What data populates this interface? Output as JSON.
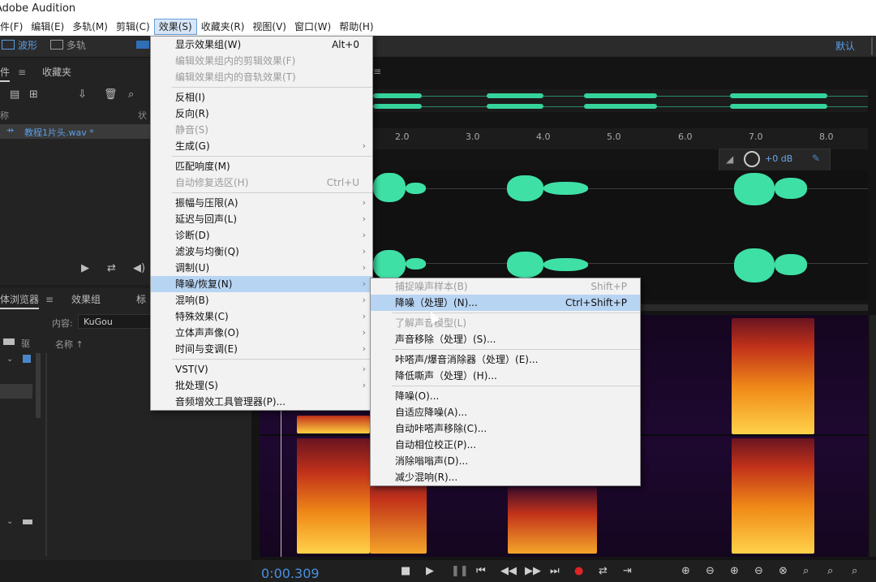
{
  "app": {
    "title": "Adobe Audition"
  },
  "menubar": {
    "items": [
      {
        "label": "件(F)"
      },
      {
        "label": "编辑(E)"
      },
      {
        "label": "多轨(M)"
      },
      {
        "label": "剪辑(C)"
      },
      {
        "label": "效果(S)"
      },
      {
        "label": "收藏夹(R)"
      },
      {
        "label": "视图(V)"
      },
      {
        "label": "窗口(W)"
      },
      {
        "label": "帮助(H)"
      }
    ]
  },
  "toolbar": {
    "waveform_label": "波形",
    "multitrack_label": "多轨",
    "workspace": "默认"
  },
  "files_panel": {
    "tabs": [
      "件",
      "收藏夹"
    ],
    "col_name": "称",
    "col_status": "状",
    "file_name": "教程1片头.wav *"
  },
  "media_panel": {
    "tabs": [
      "体浏览器",
      "效果组",
      "标"
    ],
    "content_label": "内容:",
    "content_value": "KuGou",
    "col_name": "名称 ↑",
    "drive_label": "驱"
  },
  "ruler": {
    "labels": [
      "2.0",
      "3.0",
      "4.0",
      "5.0",
      "6.0",
      "7.0",
      "8.0"
    ]
  },
  "hud": {
    "volume": "+0 dB"
  },
  "effects_menu": {
    "items": [
      {
        "label": "显示效果组(W)",
        "shortcut": "Alt+0",
        "disabled": false,
        "arrow": false
      },
      {
        "label": "编辑效果组内的剪辑效果(F)",
        "disabled": true
      },
      {
        "label": "编辑效果组内的音轨效果(T)",
        "disabled": true
      },
      {
        "sep": true
      },
      {
        "label": "反相(I)"
      },
      {
        "label": "反向(R)"
      },
      {
        "label": "静音(S)",
        "disabled": true
      },
      {
        "label": "生成(G)",
        "arrow": true
      },
      {
        "sep": true
      },
      {
        "label": "匹配响度(M)"
      },
      {
        "label": "自动修复选区(H)",
        "shortcut": "Ctrl+U",
        "disabled": true
      },
      {
        "sep": true
      },
      {
        "label": "振幅与压限(A)",
        "arrow": true
      },
      {
        "label": "延迟与回声(L)",
        "arrow": true
      },
      {
        "label": "诊断(D)",
        "arrow": true
      },
      {
        "label": "滤波与均衡(Q)",
        "arrow": true
      },
      {
        "label": "调制(U)",
        "arrow": true
      },
      {
        "label": "降噪/恢复(N)",
        "arrow": true,
        "highlight": true
      },
      {
        "label": "混响(B)",
        "arrow": true
      },
      {
        "label": "特殊效果(C)",
        "arrow": true
      },
      {
        "label": "立体声声像(O)",
        "arrow": true
      },
      {
        "label": "时间与变调(E)",
        "arrow": true
      },
      {
        "sep": true
      },
      {
        "label": "VST(V)",
        "arrow": true
      },
      {
        "label": "批处理(S)",
        "arrow": true
      },
      {
        "label": "音频增效工具管理器(P)..."
      }
    ]
  },
  "noise_submenu": {
    "items": [
      {
        "label": "捕捉噪声样本(B)",
        "shortcut": "Shift+P",
        "disabled": true
      },
      {
        "label": "降噪（处理）(N)...",
        "shortcut": "Ctrl+Shift+P",
        "highlight": true
      },
      {
        "sep": true
      },
      {
        "label": "了解声音模型(L)",
        "disabled": true
      },
      {
        "label": "声音移除（处理）(S)..."
      },
      {
        "sep": true
      },
      {
        "label": "咔嗒声/爆音消除器（处理）(E)..."
      },
      {
        "label": "降低嘶声（处理）(H)..."
      },
      {
        "sep": true
      },
      {
        "label": "降噪(O)..."
      },
      {
        "label": "自适应降噪(A)..."
      },
      {
        "label": "自动咔嗒声移除(C)..."
      },
      {
        "label": "自动相位校正(P)..."
      },
      {
        "label": "消除嗡嗡声(D)..."
      },
      {
        "label": "减少混响(R)..."
      }
    ]
  },
  "transport": {
    "time": "0:00.309"
  },
  "colors": {
    "accent": "#5a9ee6",
    "waveform": "#36d39b",
    "highlight": "#b7d4f3"
  }
}
